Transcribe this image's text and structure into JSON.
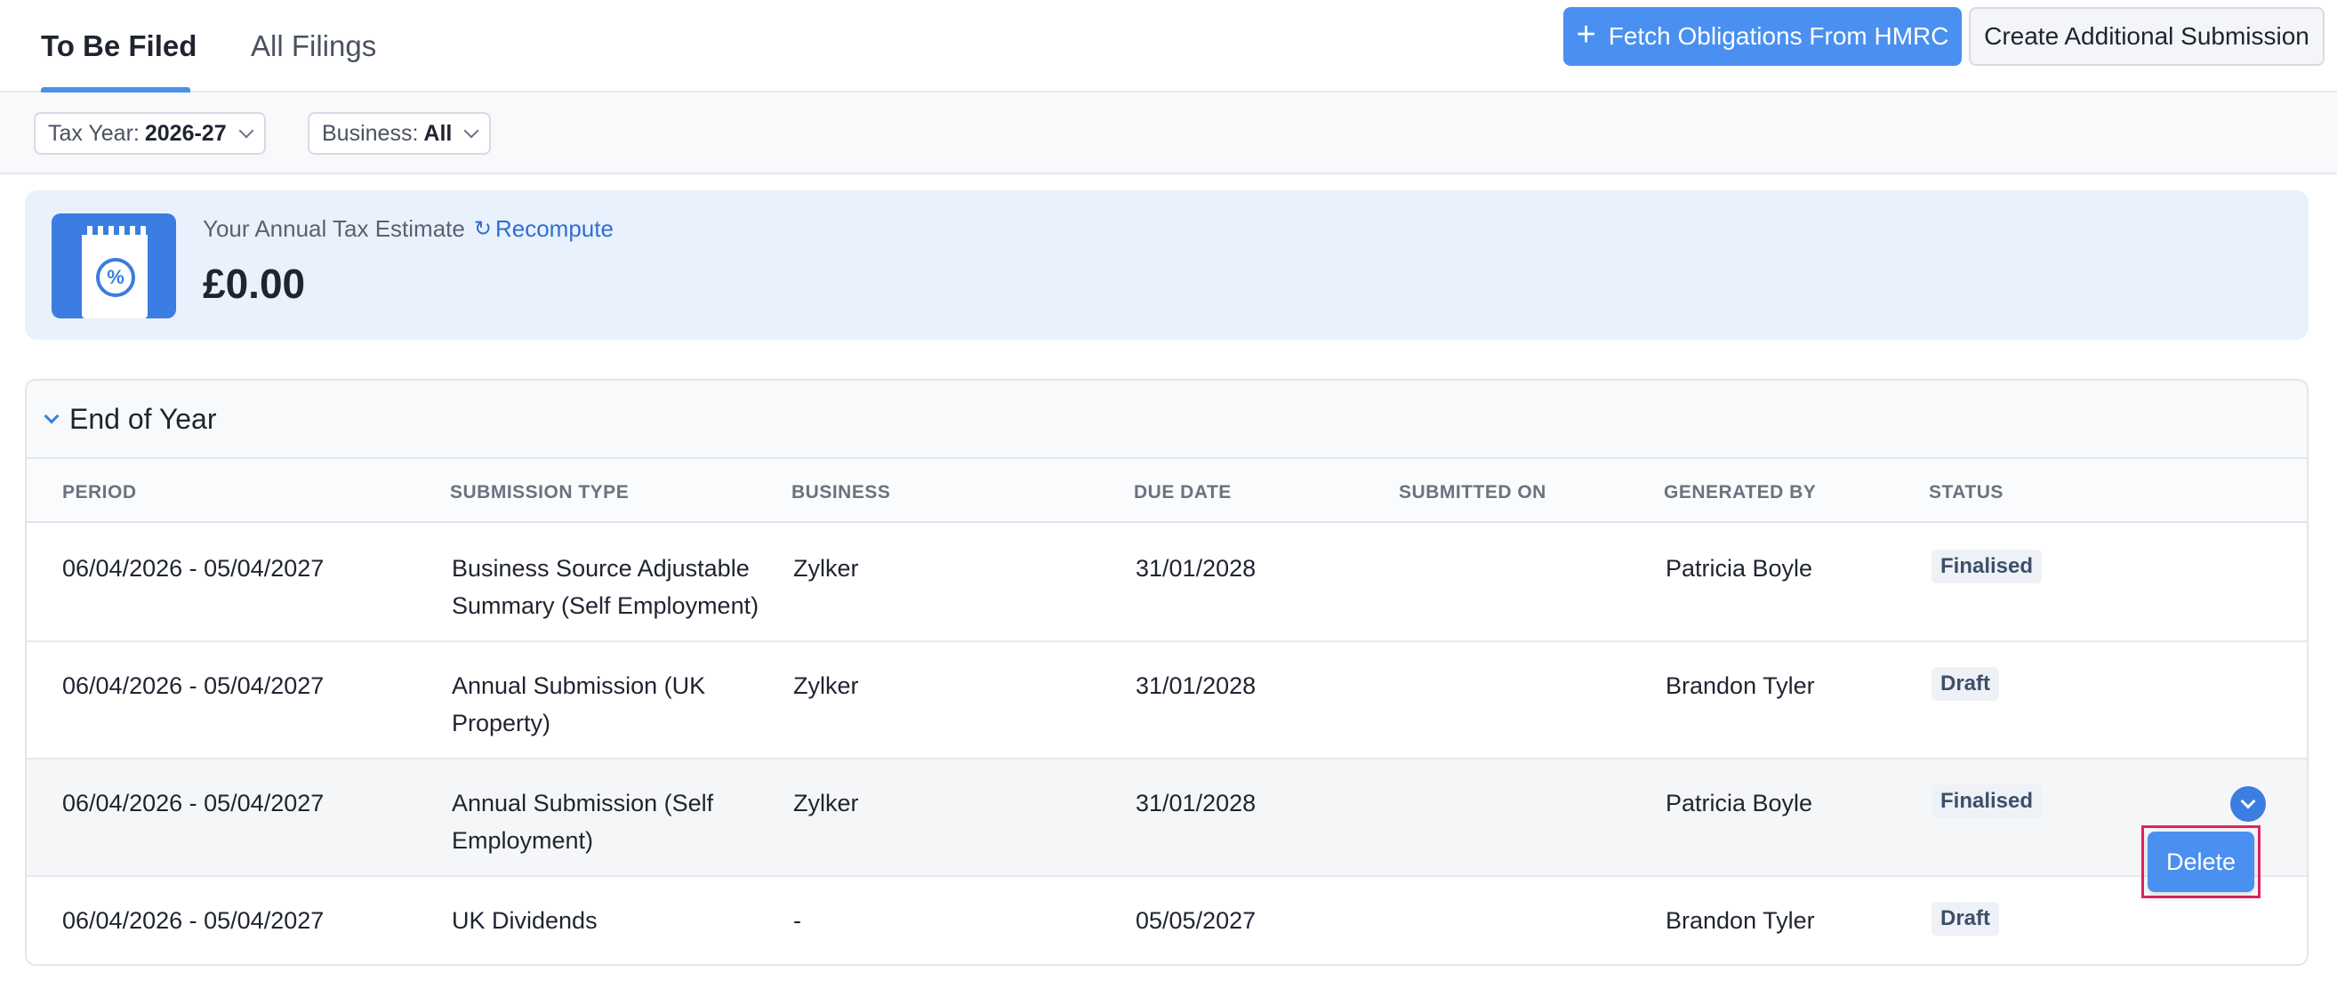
{
  "tabs": [
    {
      "label": "To Be Filed",
      "active": true
    },
    {
      "label": "All Filings",
      "active": false
    }
  ],
  "toolbar": {
    "fetch_label": "Fetch Obligations From HMRC",
    "create_label": "Create Additional Submission"
  },
  "filters": {
    "tax_year_label": "Tax Year:",
    "tax_year_value": "2026-27",
    "business_label": "Business:",
    "business_value": "All"
  },
  "estimate": {
    "label": "Your Annual Tax Estimate",
    "recompute_label": "Recompute",
    "amount": "£0.00"
  },
  "section": {
    "title": "End of Year",
    "columns": [
      "PERIOD",
      "SUBMISSION TYPE",
      "BUSINESS",
      "DUE DATE",
      "SUBMITTED ON",
      "GENERATED BY",
      "STATUS"
    ],
    "rows": [
      {
        "period": "06/04/2026 - 05/04/2027",
        "type_line1": "Business Source Adjustable",
        "type_line2": "Summary (Self Employment)",
        "business": "Zylker",
        "due": "31/01/2028",
        "submitted": "",
        "generated_by": "Patricia Boyle",
        "status": "Finalised"
      },
      {
        "period": "06/04/2026 - 05/04/2027",
        "type_line1": "Annual Submission (UK",
        "type_line2": "Property)",
        "business": "Zylker",
        "due": "31/01/2028",
        "submitted": "",
        "generated_by": "Brandon Tyler",
        "status": "Draft"
      },
      {
        "period": "06/04/2026 - 05/04/2027",
        "type_line1": "Annual Submission (Self",
        "type_line2": "Employment)",
        "business": "Zylker",
        "due": "31/01/2028",
        "submitted": "",
        "generated_by": "Patricia Boyle",
        "status": "Finalised"
      },
      {
        "period": "06/04/2026 - 05/04/2027",
        "type_line1": "UK Dividends",
        "type_line2": "",
        "business": "-",
        "due": "05/05/2027",
        "submitted": "",
        "generated_by": "Brandon Tyler",
        "status": "Draft"
      }
    ]
  },
  "row_menu": {
    "delete_label": "Delete"
  },
  "colors": {
    "accent": "#4a90f0",
    "highlight_border": "#e0245e",
    "estimate_bg": "#e9f1fd"
  }
}
